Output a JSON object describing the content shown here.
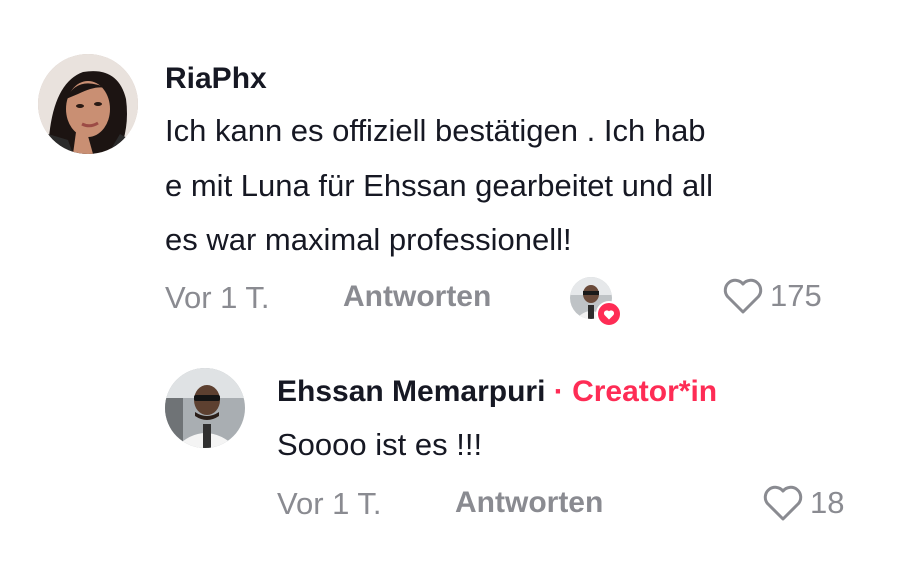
{
  "comment": {
    "username": "RiaPhx",
    "text_lines": [
      "Ich kann es offiziell bestätigen . Ich hab",
      "e mit Luna für Ehssan gearbeitet und all",
      "es war maximal professionell!"
    ],
    "time": "Vor 1 T.",
    "reply_label": "Antworten",
    "like_count": "175",
    "creator_liked": true
  },
  "reply": {
    "username": "Ehssan Memarpuri",
    "creator_label": "· Creator*in",
    "text": "Soooo ist es !!!",
    "time": "Vor 1 T.",
    "reply_label": "Antworten",
    "like_count": "18"
  },
  "colors": {
    "accent": "#fe2c55",
    "text": "#161823",
    "muted": "#8a8b91"
  }
}
